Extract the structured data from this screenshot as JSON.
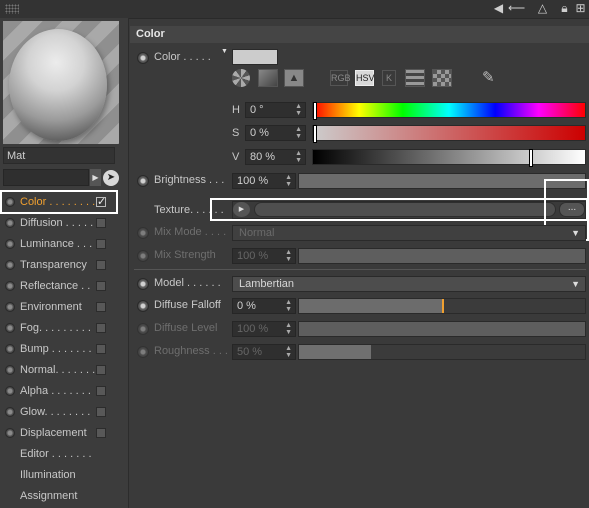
{
  "left_panel": {
    "material_name": "Mat",
    "channels": [
      {
        "label": "Color . . . . . . . .",
        "active": true,
        "has_check": true,
        "checked": true
      },
      {
        "label": "Diffusion . . . . .",
        "has_check": true
      },
      {
        "label": "Luminance . . .",
        "has_check": true
      },
      {
        "label": "Transparency",
        "has_check": true
      },
      {
        "label": "Reflectance . .",
        "has_check": true
      },
      {
        "label": "Environment",
        "has_check": true
      },
      {
        "label": "Fog. . . . . . . . .",
        "has_check": true
      },
      {
        "label": "Bump . . . . . . .",
        "has_check": true
      },
      {
        "label": "Normal. . . . . . .",
        "has_check": true
      },
      {
        "label": "Alpha . . . . . . .",
        "has_check": true
      },
      {
        "label": "Glow. . . . . . . .",
        "has_check": true
      },
      {
        "label": "Displacement",
        "has_check": true
      },
      {
        "label": "Editor . . . . . . .",
        "has_check": false
      },
      {
        "label": "Illumination",
        "has_check": false
      },
      {
        "label": "Assignment",
        "has_check": false
      }
    ]
  },
  "section": {
    "title": "Color"
  },
  "color": {
    "label": "Color . . . . .",
    "swatch_hex": "#cccccc",
    "mode_buttons": [
      "RGB",
      "HSV",
      "K"
    ],
    "active_mode": "HSV",
    "h": {
      "label": "H",
      "value": "0 °",
      "fraction": 0.0
    },
    "s": {
      "label": "S",
      "value": "0 %",
      "fraction": 0.0
    },
    "v": {
      "label": "V",
      "value": "80 %",
      "fraction": 0.8
    }
  },
  "brightness": {
    "label": "Brightness . . .",
    "value": "100 %",
    "fraction": 1.0
  },
  "texture": {
    "label": "Texture. . . . . .",
    "button_label": "..."
  },
  "mix_mode": {
    "label": "Mix Mode . . . .",
    "value": "Normal"
  },
  "mix_strength": {
    "label": "Mix Strength",
    "value": "100 %",
    "fraction": 1.0
  },
  "model": {
    "label": "Model . . . . . .",
    "value": "Lambertian"
  },
  "diffuse_falloff": {
    "label": "Diffuse Falloff",
    "value": "0 %",
    "fraction": 0.5
  },
  "diffuse_level": {
    "label": "Diffuse Level",
    "value": "100 %",
    "fraction": 1.0
  },
  "roughness": {
    "label": "Roughness . . .",
    "value": "50 %",
    "fraction": 0.25
  },
  "colors": {
    "accent": "#f0a030",
    "highlight": "#ffffff",
    "background": "#3a3a3a"
  }
}
